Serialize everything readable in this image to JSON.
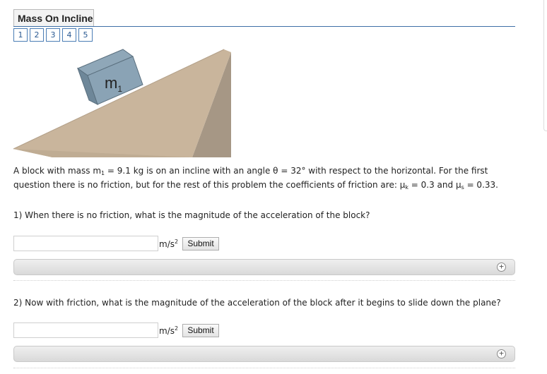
{
  "header": {
    "title": "Mass On Incline"
  },
  "pager": {
    "pages": [
      "1",
      "2",
      "3",
      "4",
      "5"
    ]
  },
  "figure": {
    "block_label": "m",
    "block_sub": "1"
  },
  "problem": {
    "p1": "A block with mass m",
    "s1": "1",
    "p2": " = 9.1 kg is on an incline with an angle θ = 32° with respect to the horizontal. For the first question there is no friction, but for the rest of this problem the coefficients of friction are: μ",
    "s2": "k",
    "p3": " = 0.3 and μ",
    "s3": "s",
    "p4": " = 0.33."
  },
  "questions": [
    {
      "text": "1) When there is no friction, what is the magnitude of the acceleration of the block?",
      "unit": "m/s",
      "unit_exp": "2",
      "submit": "Submit",
      "value": ""
    },
    {
      "text": "2) Now with friction, what is the magnitude of the acceleration of the block after it begins to slide down the plane?",
      "unit": "m/s",
      "unit_exp": "2",
      "submit": "Submit",
      "value": ""
    }
  ],
  "icons": {
    "expand": "plus-circle-icon"
  }
}
